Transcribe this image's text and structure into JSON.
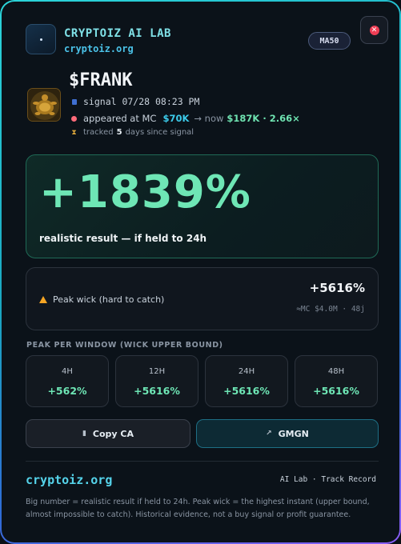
{
  "header": {
    "brand": "CRYPTOIZ AI LAB",
    "url": "cryptoiz.org",
    "badge": "MA50",
    "close_icon": "close-icon"
  },
  "token": {
    "ticker": "$FRANK",
    "signal": "signal 07/28 08:23 PM",
    "appeared_label": "appeared at MC",
    "appeared_mc": "$70K",
    "arrow_now": "→ now",
    "now_mc": "$187K · 2.66×",
    "tracked_prefix": "tracked",
    "tracked_days": "5",
    "tracked_suffix": "days since signal"
  },
  "result": {
    "percent": "+1839%",
    "caption": "realistic result — if held to 24h"
  },
  "peak": {
    "label": "Peak wick (hard to catch)",
    "value": "+5616%",
    "meta": "≈MC $4.0M · 48j"
  },
  "windows": {
    "title": "PEAK PER WINDOW (WICK UPPER BOUND)",
    "items": [
      {
        "label": "4H",
        "value": "+562%"
      },
      {
        "label": "12H",
        "value": "+5616%"
      },
      {
        "label": "24H",
        "value": "+5616%"
      },
      {
        "label": "48H",
        "value": "+5616%"
      }
    ]
  },
  "buttons": {
    "copy": "Copy CA",
    "gmgn": "GMGN"
  },
  "footer": {
    "brand": "cryptoiz.org",
    "right": "AI Lab · Track Record",
    "note": "Big number = realistic result if held to 24h. Peak wick = the highest instant (upper bound, almost impossible to catch). Historical evidence, not a buy signal or profit guarantee."
  },
  "colors": {
    "accent_green": "#6ee6b5",
    "accent_cyan": "#3ccbea",
    "warning": "#f5a524",
    "close_red": "#ef3e55"
  }
}
